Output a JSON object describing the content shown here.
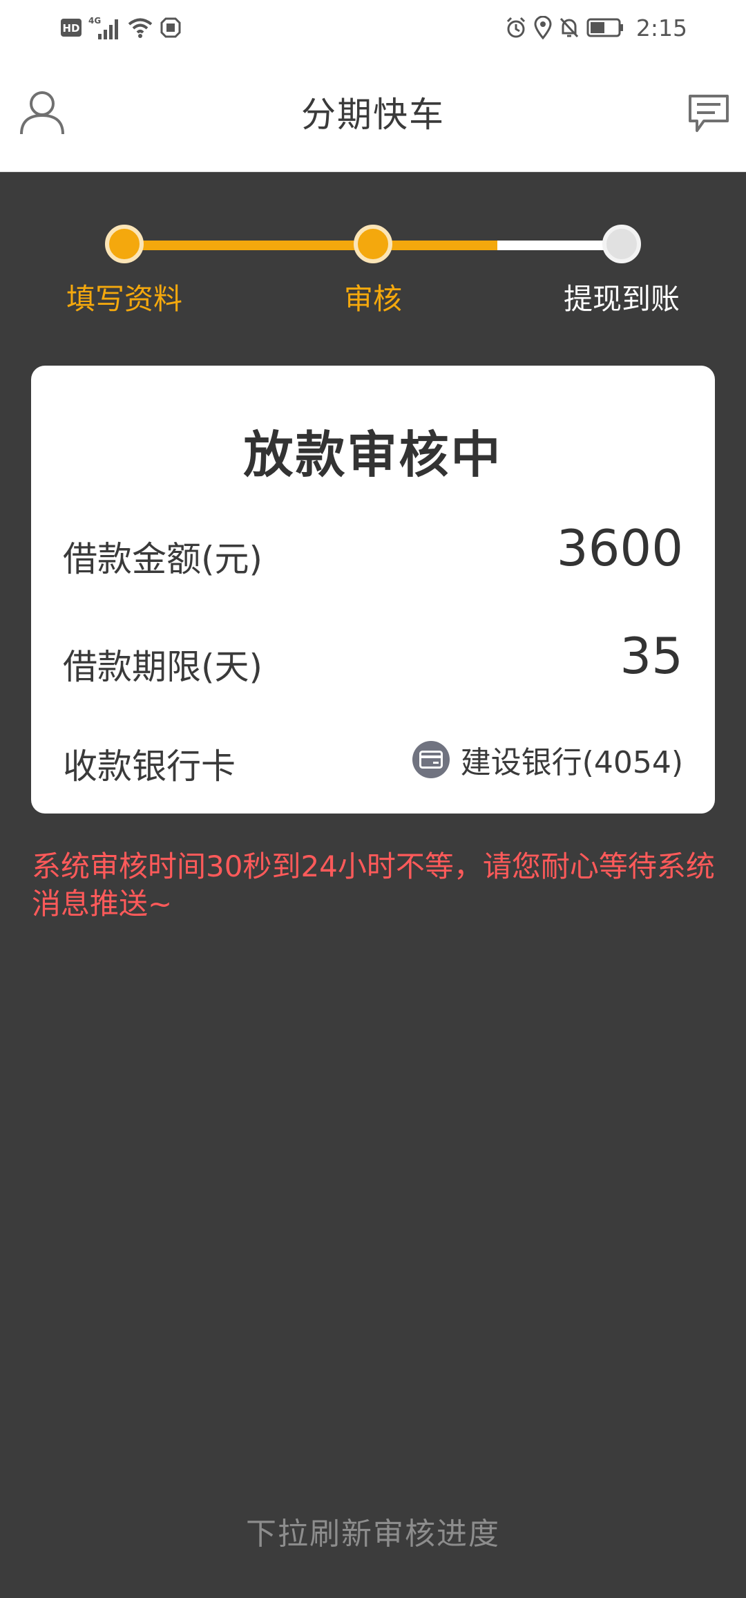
{
  "status_bar": {
    "hd_label": "HD",
    "network_label": "4G",
    "time": "2:15"
  },
  "header": {
    "title": "分期快车",
    "left_icon": "user-icon",
    "right_icon": "message-icon"
  },
  "stepper": {
    "current_step": 2,
    "steps": [
      {
        "label": "填写资料",
        "state": "active"
      },
      {
        "label": "审核",
        "state": "active"
      },
      {
        "label": "提现到账",
        "state": "inactive"
      }
    ],
    "colors": {
      "active": "#f4a80d",
      "inactive": "#e1e1e1"
    }
  },
  "card": {
    "title": "放款审核中",
    "loan_amount": {
      "label": "借款金额(元)",
      "value": "3600"
    },
    "loan_term": {
      "label": "借款期限(天)",
      "value": "35"
    },
    "bank_card": {
      "label": "收款银行卡",
      "value": "建设银行(4054)",
      "icon": "credit-card-icon"
    }
  },
  "notice": "系统审核时间30秒到24小时不等，请您耐心等待系统消息推送~",
  "pull_hint": "下拉刷新审核进度",
  "colors": {
    "accent": "#f4a80d",
    "background": "#3c3c3c",
    "notice": "#ff5a5a"
  }
}
